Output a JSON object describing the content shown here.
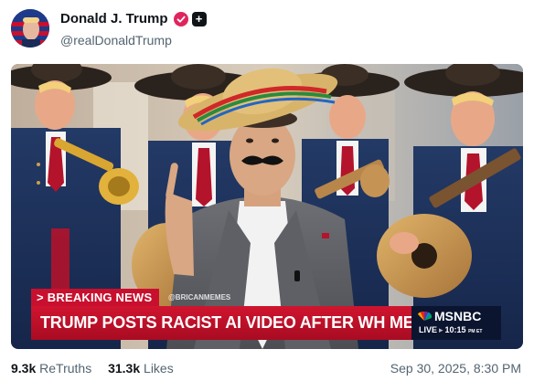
{
  "post": {
    "author": {
      "display_name": "Donald J. Trump",
      "handle": "@realDonaldTrump",
      "avatar_icon": "avatar-flag-portrait",
      "verified_color": "#e0245e"
    },
    "media": {
      "breaking_label": "BREAKING NEWS",
      "watermark": "@BRICANMEMES",
      "headline": "TRUMP POSTS RACIST AI VIDEO AFTER WH MEETING W/ DEMS",
      "network": "MSNBC",
      "live_label": "LIVE",
      "live_time": "10:15",
      "live_tz": "PM ET"
    },
    "stats": {
      "retruths_count": "9.3k",
      "retruths_label": "ReTruths",
      "likes_count": "31.3k",
      "likes_label": "Likes"
    },
    "timestamp": "Sep 30, 2025, 8:30 PM"
  }
}
